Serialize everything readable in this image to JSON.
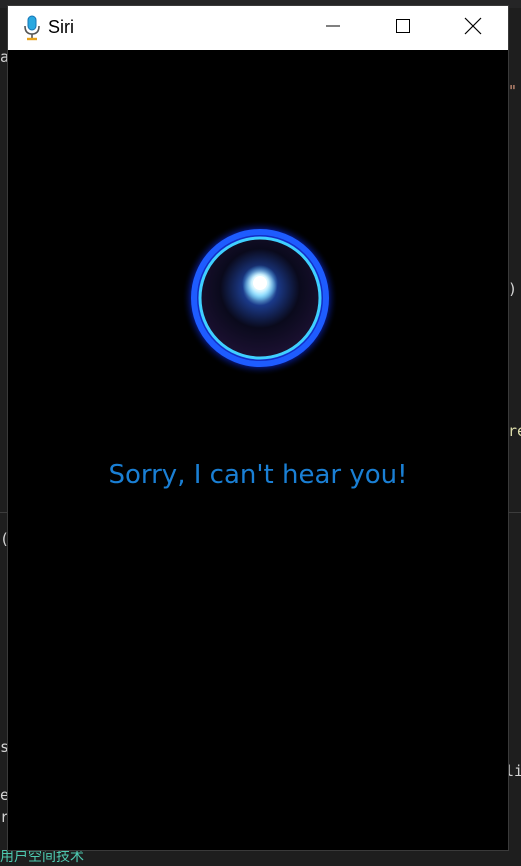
{
  "window": {
    "title": "Siri",
    "app_icon": "microphone-icon",
    "controls": {
      "minimize_icon": "minimize-icon",
      "maximize_icon": "maximize-icon",
      "close_icon": "close-icon"
    }
  },
  "main": {
    "orb_icon": "siri-orb-icon",
    "message": "Sorry, I can't hear you!"
  },
  "background": {
    "fragments": [
      "a",
      "\"",
      ")",
      "re",
      "(",
      "s",
      "e",
      "r",
      "li"
    ],
    "bottom_text": "用户空间技术"
  },
  "colors": {
    "message": "#1a7fd4",
    "orb_ring": "#1e5cff",
    "orb_glow": "#4fc3ff",
    "window_bg": "#000000",
    "titlebar_bg": "#ffffff"
  }
}
